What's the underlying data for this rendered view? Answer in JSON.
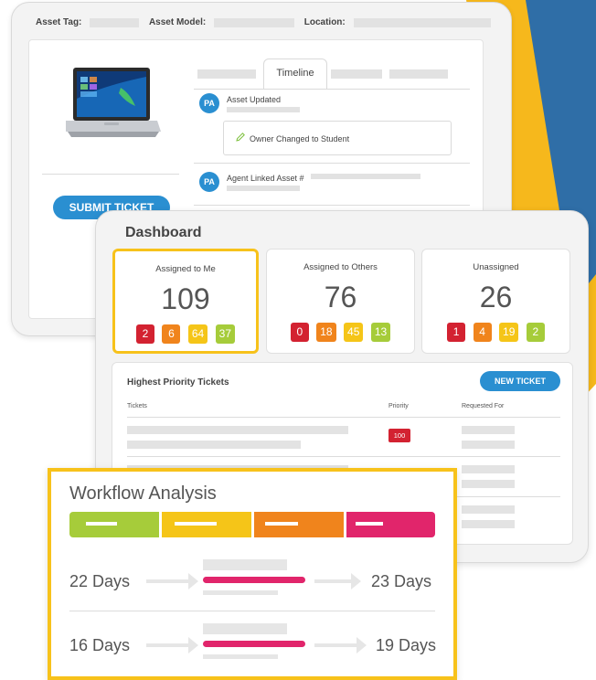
{
  "colors": {
    "accent_blue": "#2a8fd1",
    "highlight_yellow": "#f7c21b",
    "red": "#d32231",
    "orange": "#f0841c",
    "yellow": "#f5c518",
    "green": "#a6cc3a",
    "pink": "#e1256b"
  },
  "asset": {
    "filters": {
      "tag_label": "Asset Tag:",
      "model_label": "Asset Model:",
      "location_label": "Location:"
    },
    "submit_label": "SUBMIT TICKET",
    "active_tab": "Timeline",
    "timeline": [
      {
        "avatar": "PA",
        "title": "Asset Updated",
        "detail": "Owner Changed to Student"
      },
      {
        "avatar": "PA",
        "title": "Agent Linked Asset #"
      }
    ]
  },
  "dashboard": {
    "title": "Dashboard",
    "cards": [
      {
        "label": "Assigned to Me",
        "count": "109",
        "badges": [
          "2",
          "6",
          "64",
          "37"
        ]
      },
      {
        "label": "Assigned to Others",
        "count": "76",
        "badges": [
          "0",
          "18",
          "45",
          "13"
        ]
      },
      {
        "label": "Unassigned",
        "count": "26",
        "badges": [
          "1",
          "4",
          "19",
          "2"
        ]
      }
    ],
    "priority": {
      "title": "Highest Priority Tickets",
      "new_ticket_label": "NEW TICKET",
      "columns": [
        "Tickets",
        "Priority",
        "Requested For"
      ],
      "first_priority": "100"
    }
  },
  "workflow": {
    "title": "Workflow Analysis",
    "rows": [
      {
        "from": "22 Days",
        "to": "23 Days"
      },
      {
        "from": "16 Days",
        "to": "19 Days"
      }
    ]
  }
}
